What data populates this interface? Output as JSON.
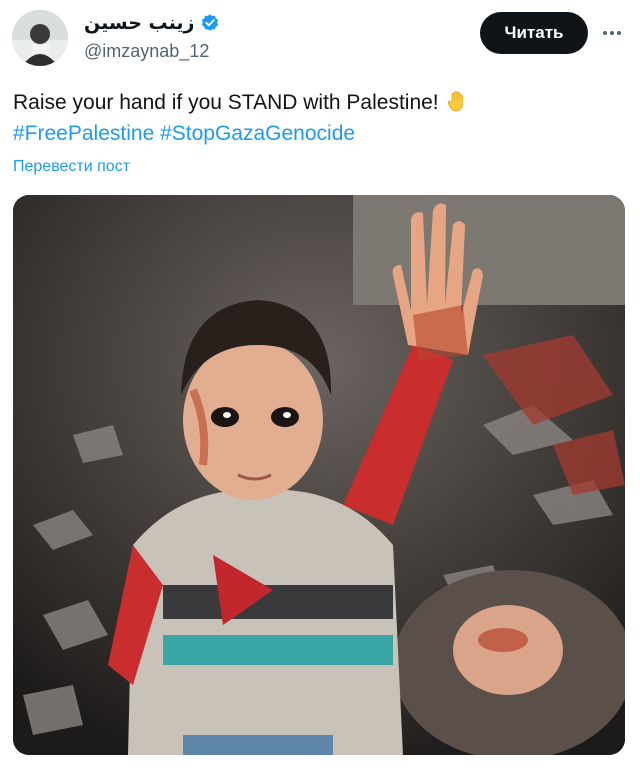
{
  "author": {
    "display_name": "زينب حسين",
    "handle": "@imzaynab_12",
    "verified": true
  },
  "actions": {
    "follow_label": "Читать",
    "more_icon": "more-horizontal-icon"
  },
  "post": {
    "text_line1": "Raise your hand if you STAND with Palestine!",
    "emoji": "raised-hand-icon",
    "hashtags": [
      "#FreePalestine",
      "#StopGazaGenocide"
    ],
    "translate_label": "Перевести пост"
  },
  "colors": {
    "accent": "#1d9bf0",
    "button_bg": "#0f1419",
    "handle_gray": "#536471"
  }
}
